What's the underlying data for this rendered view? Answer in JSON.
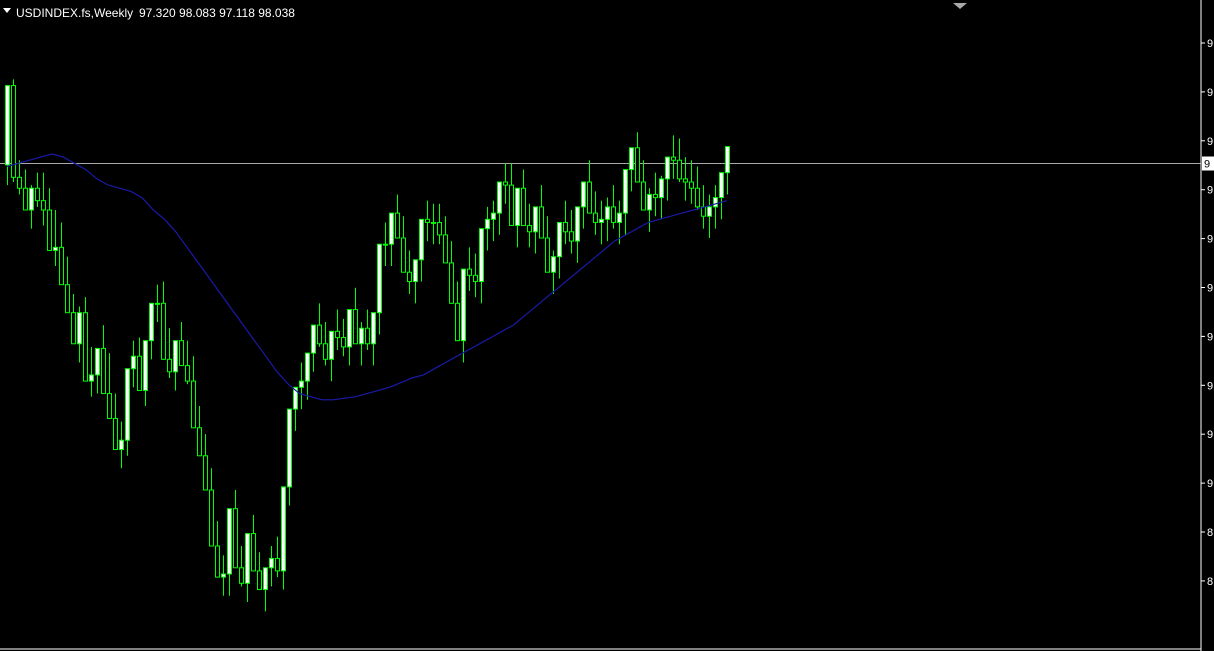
{
  "header": {
    "symbol_line": "USDINDEX.fs,Weekly",
    "ohlc": "97.320 98.083 97.118 98.038"
  },
  "colors": {
    "background": "#000000",
    "frame": "#ffffff",
    "bull_body": "#ffffff",
    "bear_body": "#000000",
    "candle_line": "#00ff00",
    "ma_line": "#1a1aaa",
    "price_line": "#a9a9a9",
    "marker_bg": "#ffffff"
  },
  "axis": {
    "tick_labels": [
      "9",
      "9",
      "9",
      "9",
      "9",
      "9",
      "9",
      "9",
      "9",
      "9",
      "8",
      "8"
    ],
    "price_marker_label": "9"
  },
  "chart_data": {
    "type": "candlestick",
    "x": [
      0,
      1,
      2,
      3,
      4,
      5,
      6,
      7,
      8,
      9,
      10,
      11,
      12,
      13,
      14,
      15,
      16,
      17,
      18,
      19,
      20,
      21,
      22,
      23,
      24,
      25,
      26,
      27,
      28,
      29,
      30,
      31,
      32,
      33,
      34,
      35,
      36,
      37,
      38,
      39,
      40,
      41,
      42,
      43,
      44,
      45,
      46,
      47,
      48,
      49,
      50,
      51,
      52,
      53,
      54,
      55,
      56,
      57,
      58,
      59,
      60,
      61,
      62,
      63,
      64,
      65,
      66,
      67,
      68,
      69,
      70,
      71,
      72,
      73,
      74,
      75,
      76,
      77,
      78,
      79,
      80,
      81,
      82,
      83,
      84,
      85,
      86,
      87,
      88,
      89,
      90,
      91,
      92,
      93,
      94,
      95,
      96,
      97,
      98,
      99,
      100,
      101,
      102,
      103,
      104,
      105,
      106,
      107,
      108,
      109,
      110,
      111,
      112,
      113,
      114,
      115,
      116,
      117,
      118,
      119,
      120,
      121,
      122,
      123,
      124,
      125,
      126,
      127,
      128,
      129,
      130,
      131,
      132,
      133,
      134,
      135,
      136,
      137,
      138,
      139,
      140,
      141,
      142,
      143,
      144,
      145,
      146,
      147,
      148,
      149,
      150,
      151,
      152,
      153,
      154,
      155,
      156
    ],
    "open": [
      97.45,
      100.0,
      97.05,
      96.7,
      96.0,
      96.7,
      96.3,
      96.0,
      94.7,
      94.8,
      93.6,
      92.7,
      91.7,
      92.7,
      90.5,
      90.7,
      91.55,
      90.1,
      89.3,
      88.3,
      88.6,
      90.9,
      91.3,
      90.2,
      91.8,
      93.0,
      93.0,
      91.2,
      90.8,
      91.8,
      91.0,
      90.5,
      89.0,
      88.1,
      87.0,
      85.2,
      84.2,
      84.3,
      86.4,
      84.5,
      84.0,
      85.6,
      84.4,
      83.8,
      84.5,
      84.8,
      84.4,
      87.1,
      89.6,
      90.3,
      90.5,
      91.4,
      92.3,
      91.7,
      91.2,
      92.1,
      91.9,
      91.6,
      92.8,
      91.7,
      92.2,
      91.7,
      92.7,
      94.9,
      94.9,
      95.9,
      95.1,
      94.0,
      93.7,
      94.4,
      95.7,
      95.6,
      95.6,
      95.2,
      94.3,
      93.0,
      91.8,
      94.1,
      93.9,
      93.7,
      95.4,
      95.7,
      95.9,
      96.9,
      96.8,
      95.5,
      96.7,
      95.5,
      95.3,
      96.1,
      95.1,
      94.0,
      94.5,
      95.6,
      95.3,
      95.0,
      96.1,
      96.9,
      95.9,
      95.6,
      95.7,
      96.1,
      95.6,
      95.9,
      97.3,
      98.0,
      96.9,
      96.0,
      96.5,
      96.4,
      97.0,
      97.7,
      97.6,
      97.0,
      96.9,
      96.7,
      96.1,
      95.8,
      96.1,
      96.4,
      97.2
    ],
    "high": [
      97.9,
      100.2,
      97.6,
      97.3,
      96.8,
      97.2,
      97.2,
      96.7,
      96.0,
      95.6,
      94.5,
      93.3,
      92.9,
      93.2,
      91.6,
      91.4,
      92.3,
      91.4,
      90.1,
      89.2,
      89.8,
      91.8,
      91.9,
      91.3,
      92.6,
      93.6,
      93.7,
      92.2,
      91.5,
      92.4,
      91.8,
      91.3,
      89.7,
      88.8,
      87.7,
      86.0,
      84.9,
      85.0,
      87.0,
      85.2,
      84.9,
      86.2,
      85.0,
      84.5,
      85.2,
      85.5,
      85.2,
      87.8,
      90.3,
      91.1,
      91.3,
      92.1,
      93.0,
      92.4,
      91.8,
      92.8,
      92.5,
      92.2,
      93.5,
      92.4,
      92.8,
      92.3,
      93.4,
      95.6,
      95.6,
      96.5,
      95.8,
      94.7,
      94.4,
      95.1,
      96.3,
      96.2,
      96.2,
      95.8,
      95.0,
      93.7,
      92.6,
      94.8,
      94.6,
      94.4,
      96.1,
      96.3,
      96.6,
      97.5,
      97.5,
      96.2,
      97.3,
      96.2,
      96.0,
      96.8,
      95.8,
      94.7,
      95.2,
      96.3,
      96.0,
      95.7,
      96.8,
      97.6,
      96.6,
      96.3,
      96.4,
      96.8,
      96.3,
      96.6,
      97.9,
      98.5,
      97.6,
      96.7,
      97.2,
      97.1,
      97.7,
      98.4,
      98.3,
      97.7,
      97.6,
      97.4,
      96.8,
      96.5,
      96.8,
      97.1,
      97.9
    ],
    "low": [
      96.8,
      96.9,
      96.5,
      96.1,
      95.4,
      96.1,
      95.5,
      95.3,
      94.2,
      94.1,
      92.9,
      91.9,
      91.1,
      91.9,
      90.0,
      90.1,
      91.0,
      89.6,
      88.6,
      87.7,
      88.1,
      90.3,
      90.7,
      89.7,
      91.2,
      92.4,
      92.4,
      90.6,
      90.2,
      91.2,
      90.4,
      89.8,
      88.3,
      87.4,
      86.3,
      84.5,
      83.6,
      83.6,
      85.8,
      83.9,
      83.4,
      85.0,
      83.8,
      83.1,
      83.9,
      84.2,
      83.8,
      86.5,
      88.9,
      89.6,
      89.9,
      90.8,
      91.6,
      91.0,
      90.5,
      91.5,
      91.3,
      91.0,
      92.1,
      91.0,
      91.5,
      91.0,
      92.0,
      94.2,
      94.2,
      95.2,
      94.4,
      93.3,
      93.0,
      93.7,
      95.0,
      94.9,
      94.9,
      94.5,
      93.6,
      92.3,
      91.1,
      93.4,
      93.2,
      93.0,
      94.7,
      95.0,
      95.2,
      96.2,
      96.1,
      94.8,
      96.0,
      94.8,
      94.6,
      95.4,
      94.4,
      93.3,
      93.8,
      94.9,
      94.6,
      94.3,
      95.4,
      96.2,
      95.2,
      94.9,
      95.0,
      95.4,
      94.9,
      95.2,
      96.6,
      97.3,
      96.2,
      95.3,
      95.8,
      95.7,
      96.3,
      97.0,
      96.9,
      96.3,
      96.2,
      96.0,
      95.4,
      95.1,
      95.4,
      95.7,
      96.5
    ],
    "close": [
      100.0,
      97.05,
      96.7,
      96.0,
      96.7,
      96.3,
      96.0,
      94.7,
      94.8,
      93.6,
      92.7,
      91.7,
      92.7,
      90.5,
      90.7,
      91.55,
      90.1,
      89.3,
      88.3,
      88.6,
      90.9,
      91.3,
      90.2,
      91.8,
      93.0,
      93.0,
      91.2,
      90.8,
      91.8,
      91.0,
      90.5,
      89.0,
      88.1,
      87.0,
      85.2,
      84.2,
      84.3,
      86.4,
      84.5,
      84.0,
      85.6,
      84.4,
      83.8,
      84.5,
      84.8,
      84.4,
      87.1,
      89.6,
      90.3,
      90.5,
      91.4,
      92.3,
      91.7,
      91.2,
      92.1,
      91.9,
      91.6,
      92.8,
      91.7,
      92.2,
      91.7,
      92.7,
      94.9,
      94.9,
      95.9,
      95.1,
      94.0,
      93.7,
      94.4,
      95.7,
      95.6,
      95.6,
      95.2,
      94.3,
      93.0,
      91.8,
      94.1,
      93.9,
      93.7,
      95.4,
      95.7,
      95.9,
      96.9,
      96.8,
      95.5,
      96.7,
      95.5,
      95.3,
      96.1,
      95.1,
      94.0,
      94.5,
      95.6,
      95.3,
      95.0,
      96.1,
      96.9,
      95.9,
      95.6,
      95.7,
      96.1,
      95.6,
      95.9,
      97.3,
      98.0,
      96.9,
      96.0,
      96.5,
      96.4,
      97.0,
      97.7,
      97.6,
      97.0,
      96.9,
      96.7,
      96.1,
      95.8,
      96.1,
      96.4,
      97.2,
      98.038
    ],
    "ma": [
      97.4,
      97.5,
      97.6,
      97.7,
      97.8,
      97.7,
      97.5,
      97.3,
      97.0,
      96.8,
      96.7,
      96.6,
      96.4,
      96.0,
      95.7,
      95.3,
      94.8,
      94.3,
      93.8,
      93.3,
      92.8,
      92.3,
      91.8,
      91.3,
      90.8,
      90.4,
      90.1,
      90.0,
      89.9,
      89.9,
      89.95,
      90.0,
      90.1,
      90.2,
      90.3,
      90.45,
      90.6,
      90.7,
      90.9,
      91.1,
      91.3,
      91.5,
      91.7,
      91.9,
      92.1,
      92.3,
      92.6,
      92.9,
      93.2,
      93.5,
      93.8,
      94.1,
      94.4,
      94.7,
      95.0,
      95.2,
      95.4,
      95.6,
      95.7,
      95.8,
      95.9,
      96.0,
      96.1,
      96.2,
      96.3
    ],
    "current_price": 97.5,
    "ylim": [
      82.5,
      100.5
    ]
  }
}
